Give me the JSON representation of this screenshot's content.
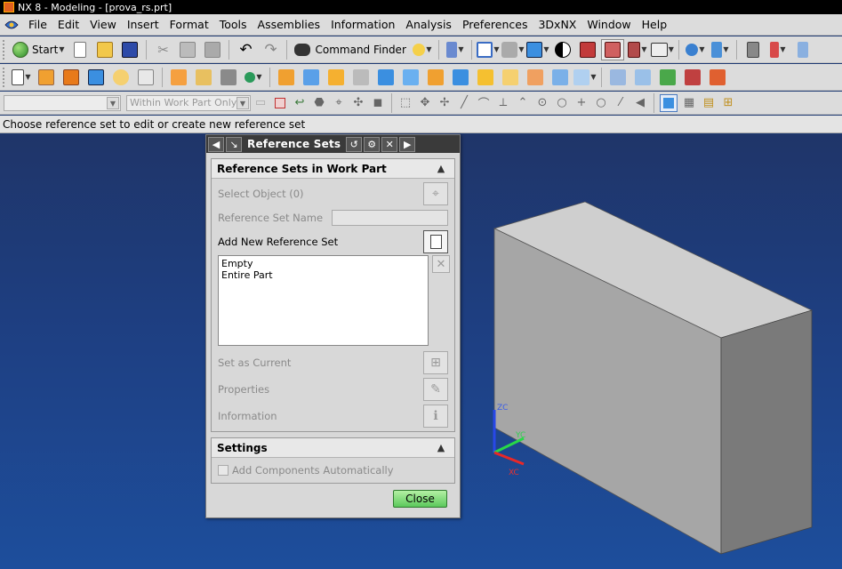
{
  "window": {
    "title": "NX 8 - Modeling - [prova_rs.prt]"
  },
  "menu": [
    "File",
    "Edit",
    "View",
    "Insert",
    "Format",
    "Tools",
    "Assemblies",
    "Information",
    "Analysis",
    "Preferences",
    "3DxNX",
    "Window",
    "Help"
  ],
  "toolbar": {
    "start_label": "Start",
    "command_finder_label": "Command Finder",
    "selection_scope": "Within Work Part Only"
  },
  "cue_line": "Choose reference set to edit or create new reference set",
  "dialog": {
    "title": "Reference Sets",
    "section_main": {
      "title": "Reference Sets in Work Part",
      "select_object_label": "Select Object (0)",
      "reference_set_name_label": "Reference Set Name",
      "reference_set_name_value": "",
      "add_new_label": "Add New Reference Set",
      "list_items": [
        "Empty",
        "Entire Part"
      ],
      "set_as_current_label": "Set as Current",
      "properties_label": "Properties",
      "information_label": "Information"
    },
    "section_settings": {
      "title": "Settings",
      "add_components_label": "Add Components Automatically",
      "add_components_checked": false
    },
    "close_label": "Close"
  },
  "triad": {
    "x_label": "XC",
    "y_label": "YC",
    "z_label": "ZC"
  },
  "colors": {
    "title_bar": "#000000",
    "viewport_top": "#1f3569",
    "viewport_bottom": "#1d4e9c",
    "close_button": "#5cc95c",
    "block_front": "#7a7a7a",
    "block_top": "#cfcfcf"
  }
}
